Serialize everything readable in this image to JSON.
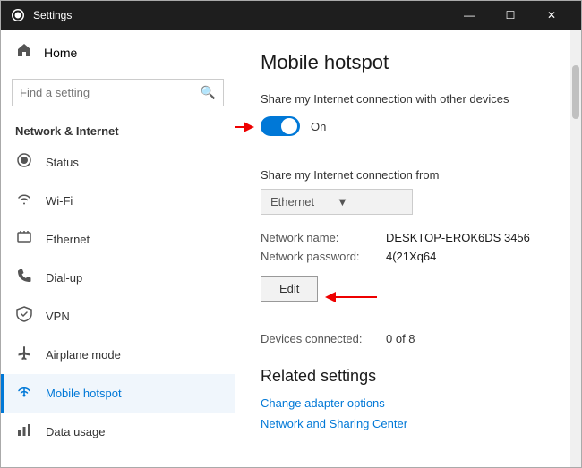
{
  "titlebar": {
    "icon": "⚙",
    "title": "Settings",
    "min": "—",
    "max": "☐",
    "close": "✕"
  },
  "sidebar": {
    "home_label": "Home",
    "search_placeholder": "Find a setting",
    "section_label": "Network & Internet",
    "items": [
      {
        "id": "status",
        "label": "Status",
        "icon": "●"
      },
      {
        "id": "wifi",
        "label": "Wi-Fi",
        "icon": "wifi"
      },
      {
        "id": "ethernet",
        "label": "Ethernet",
        "icon": "ethernet"
      },
      {
        "id": "dialup",
        "label": "Dial-up",
        "icon": "phone"
      },
      {
        "id": "vpn",
        "label": "VPN",
        "icon": "vpn"
      },
      {
        "id": "airplane",
        "label": "Airplane mode",
        "icon": "plane"
      },
      {
        "id": "hotspot",
        "label": "Mobile hotspot",
        "icon": "hotspot",
        "active": true
      },
      {
        "id": "datausage",
        "label": "Data usage",
        "icon": "data"
      }
    ]
  },
  "main": {
    "page_title": "Mobile hotspot",
    "share_desc": "Share my Internet connection with other devices",
    "toggle_state": "On",
    "share_from_label": "Share my Internet connection from",
    "dropdown_value": "Ethernet",
    "network_name_label": "Network name:",
    "network_name_value": "DESKTOP-EROK6DS 3456",
    "network_password_label": "Network password:",
    "network_password_value": "4(21Xq64",
    "edit_label": "Edit",
    "devices_label": "Devices connected:",
    "devices_value": "0 of 8",
    "related_title": "Related settings",
    "link1": "Change adapter options",
    "link2": "Network and Sharing Center"
  }
}
